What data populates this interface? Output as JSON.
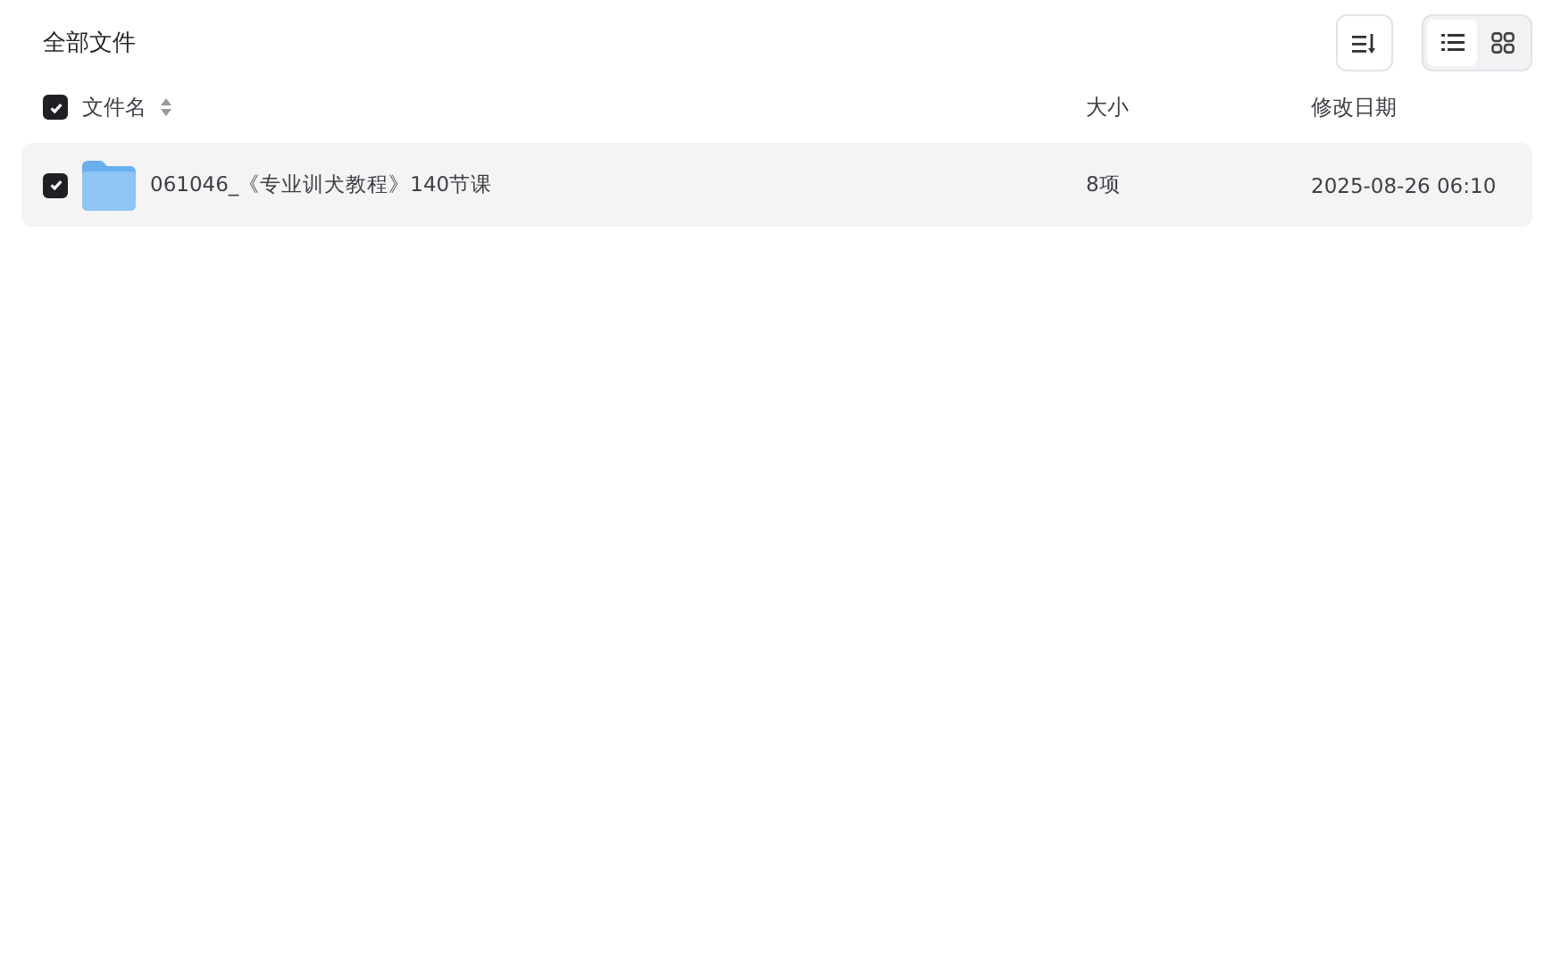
{
  "title": "全部文件",
  "view_modes": [
    {
      "kind": "list",
      "selected": true
    },
    {
      "kind": "grid",
      "selected": false
    }
  ],
  "table": {
    "all_checked": true,
    "columns": [
      "文件名",
      "大小",
      "修改日期"
    ],
    "rows": [
      {
        "name": "061046_《专业训犬教程》140节课",
        "size": "8项",
        "modified": "2025-08-26 06:10",
        "checked": true
      }
    ]
  }
}
